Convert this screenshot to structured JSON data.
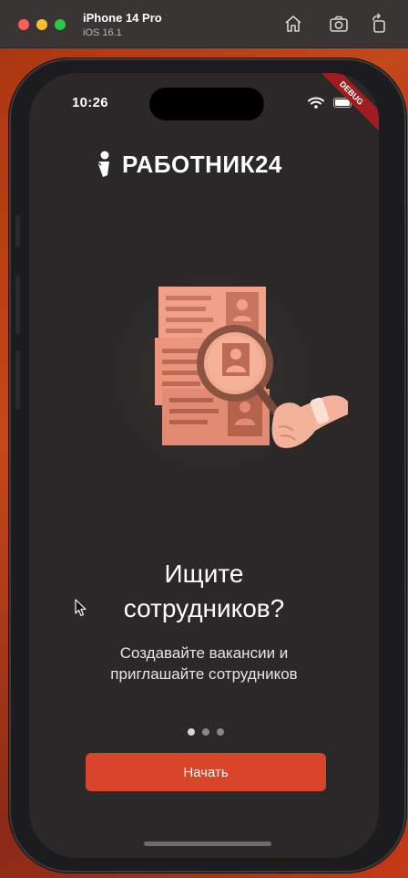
{
  "window": {
    "device_name": "iPhone 14 Pro",
    "os_version": "iOS 16.1",
    "toolbar_icons": [
      "home-icon",
      "screenshot-icon",
      "rotate-icon"
    ]
  },
  "status_bar": {
    "time": "10:26",
    "debug_banner": "DEBUG"
  },
  "app": {
    "logo_text": "РАБОТНИК24",
    "headline_line1": "Ищите",
    "headline_line2": "сотрудников?",
    "subtitle_line1": "Создавайте вакансии и",
    "subtitle_line2": "приглашайте сотрудников",
    "page_indicator": {
      "count": 3,
      "active_index": 0
    },
    "start_button": "Начать"
  },
  "colors": {
    "accent": "#d8452a",
    "screen_bg": "#2a2828",
    "illustration": "#e8937a"
  }
}
